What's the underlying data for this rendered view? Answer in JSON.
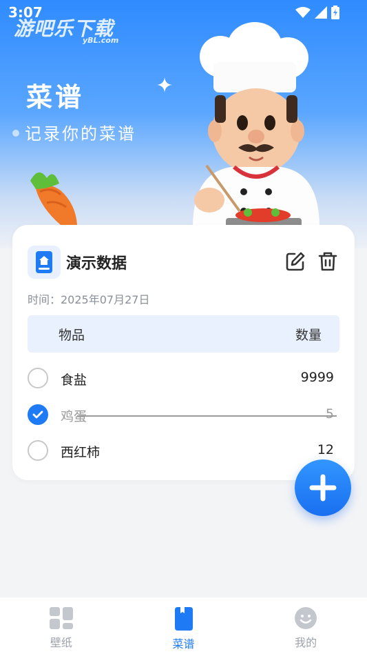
{
  "status": {
    "time": "3:07"
  },
  "watermark": {
    "text": "游吧乐下载",
    "sub": "yBL.com"
  },
  "hero": {
    "title": "菜谱",
    "subtitle": "记录你的菜谱"
  },
  "recipe": {
    "title": "演示数据",
    "time": "时间：2025年07月27日",
    "table": {
      "col_item": "物品",
      "col_qty": "数量"
    },
    "items": [
      {
        "name": "食盐",
        "qty": "9999",
        "checked": false
      },
      {
        "name": "鸡蛋",
        "qty": "5",
        "checked": true
      },
      {
        "name": "西红柿",
        "qty": "12",
        "checked": false
      }
    ]
  },
  "tabs": [
    {
      "label": "壁纸",
      "icon": "wallpaper-icon",
      "active": false
    },
    {
      "label": "菜谱",
      "icon": "recipe-icon",
      "active": true
    },
    {
      "label": "我的",
      "icon": "profile-icon",
      "active": false
    }
  ],
  "colors": {
    "accent": "#1e7bf5",
    "hero_top": "#2f8bff",
    "inactive": "#9ea3ab"
  }
}
